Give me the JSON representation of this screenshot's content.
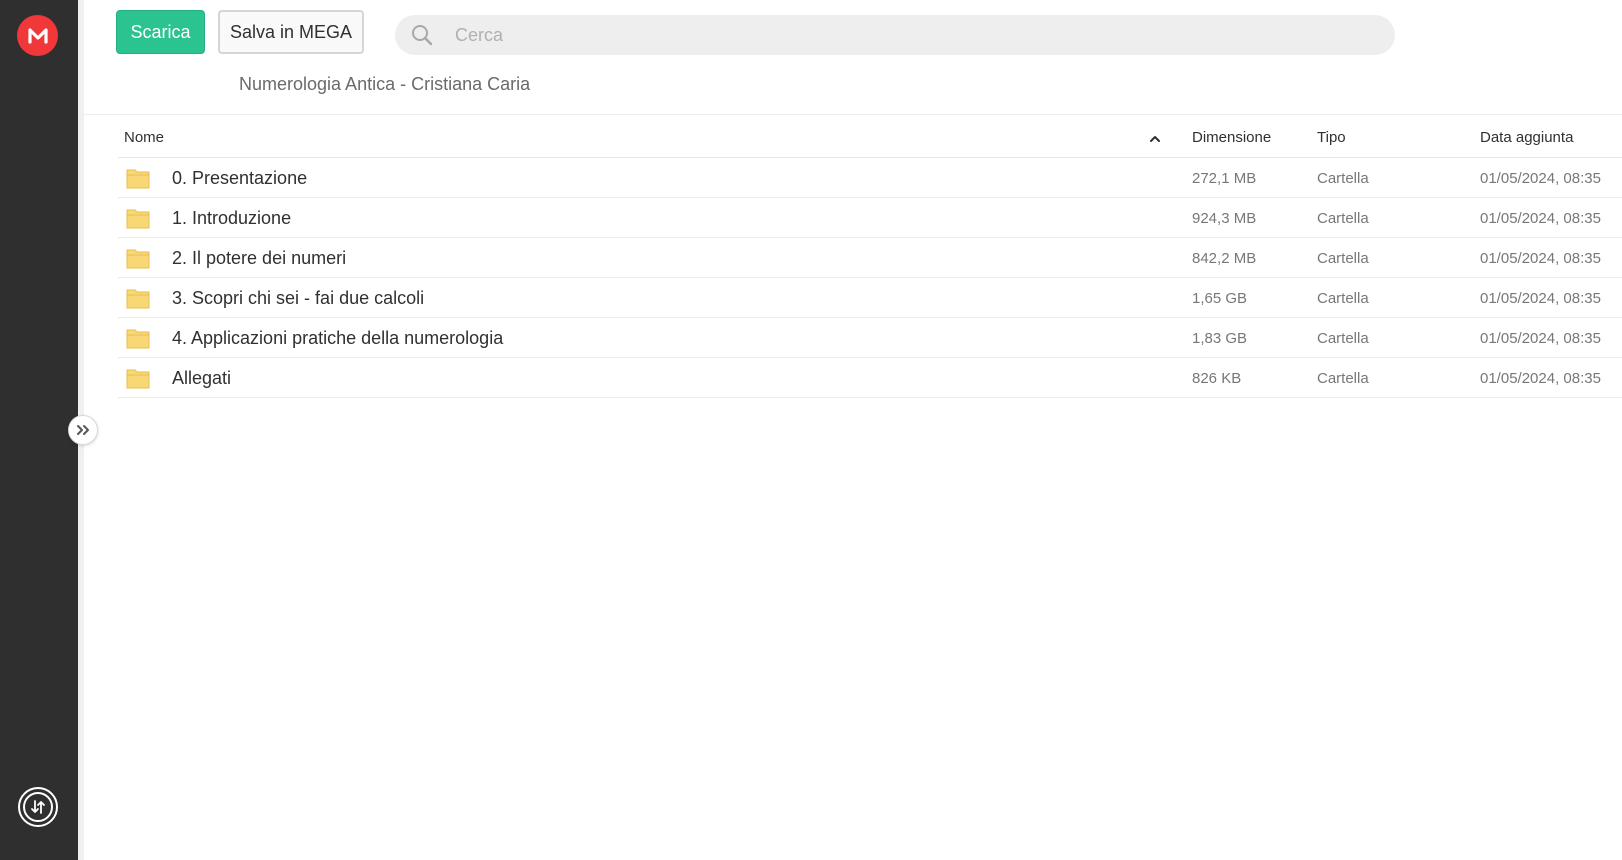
{
  "app": {
    "name": "MEGA"
  },
  "toolbar": {
    "download_label": "Scarica",
    "save_label": "Salva in MEGA"
  },
  "search": {
    "placeholder": "Cerca",
    "value": ""
  },
  "breadcrumb": {
    "title": "Numerologia Antica - Cristiana Caria"
  },
  "columns": {
    "name": "Nome",
    "size": "Dimensione",
    "type": "Tipo",
    "date": "Data aggiunta"
  },
  "rows": [
    {
      "name": "0. Presentazione",
      "size": "272,1 MB",
      "type": "Cartella",
      "date": "01/05/2024, 08:35"
    },
    {
      "name": "1. Introduzione",
      "size": "924,3 MB",
      "type": "Cartella",
      "date": "01/05/2024, 08:35"
    },
    {
      "name": "2. Il potere dei numeri",
      "size": "842,2 MB",
      "type": "Cartella",
      "date": "01/05/2024, 08:35"
    },
    {
      "name": "3. Scopri chi sei - fai due calcoli",
      "size": "1,65 GB",
      "type": "Cartella",
      "date": "01/05/2024, 08:35"
    },
    {
      "name": "4. Applicazioni pratiche della numerologia",
      "size": "1,83 GB",
      "type": "Cartella",
      "date": "01/05/2024, 08:35"
    },
    {
      "name": "Allegati",
      "size": "826 KB",
      "type": "Cartella",
      "date": "01/05/2024, 08:35"
    }
  ],
  "icons": {
    "logo": "mega-logo-icon",
    "folder": "folder-icon",
    "search": "search-icon",
    "sort": "chevron-up-icon",
    "expand": "double-chevron-right-icon",
    "transfers": "transfer-icon"
  },
  "colors": {
    "brand": "#f0373a",
    "accent": "#2bc38f",
    "sidebar": "#2f2f2f",
    "folder": "#f8d775"
  }
}
